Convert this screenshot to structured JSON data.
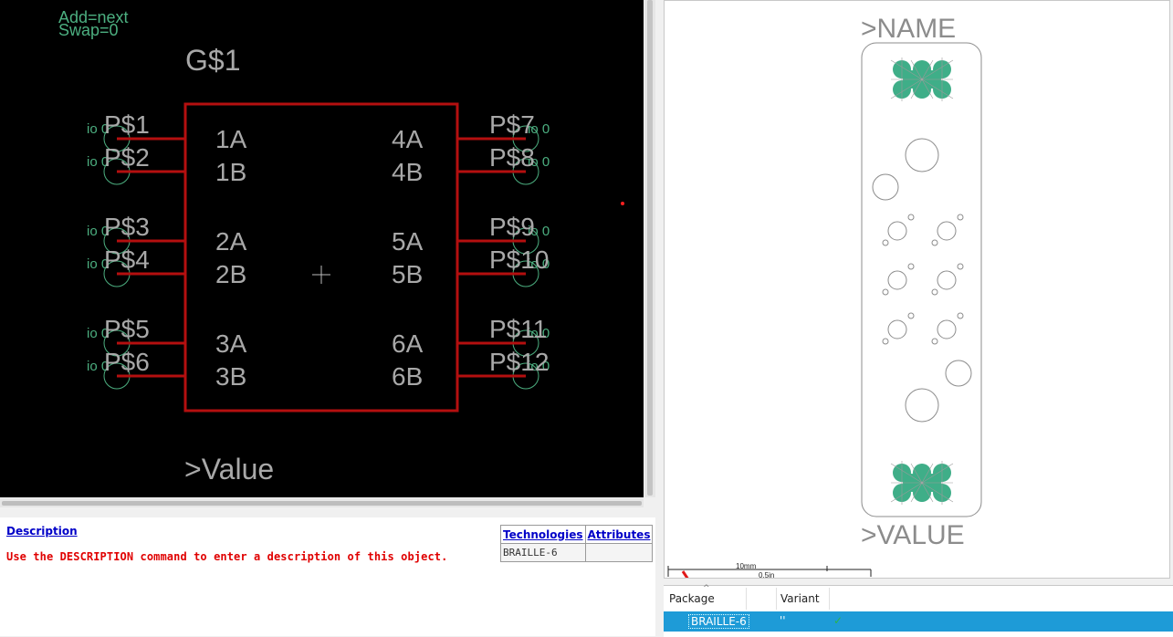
{
  "schematic": {
    "add_label": "Add=next",
    "swap_label": "Swap=0",
    "gate_name": "G$1",
    "value_label": ">Value",
    "pin_io_label": "io 0",
    "pins_left": [
      "P$1",
      "P$2",
      "P$3",
      "P$4",
      "P$5",
      "P$6"
    ],
    "pins_right": [
      "P$7",
      "P$8",
      "P$9",
      "P$10",
      "P$11",
      "P$12"
    ],
    "inner_left": [
      "1A",
      "1B",
      "2A",
      "2B",
      "3A",
      "3B"
    ],
    "inner_right": [
      "4A",
      "4B",
      "5A",
      "5B",
      "6A",
      "6B"
    ],
    "colors": {
      "body": "#b40f0f",
      "text": "#a8a8a8",
      "io_text": "#4caf80",
      "background": "#000000"
    }
  },
  "description": {
    "link": "Description",
    "text": "Use the DESCRIPTION command to enter a description of this object."
  },
  "tech_table": {
    "headers": [
      "Technologies",
      "Attributes"
    ],
    "rows": [
      [
        "BRAILLE-6",
        ""
      ]
    ]
  },
  "package_view": {
    "name_label": ">NAME",
    "value_label": ">VALUE",
    "scale_mm": "10mm",
    "scale_in": "0.5in",
    "colors": {
      "pad": "#3fae88",
      "outline": "#8c8c8c"
    }
  },
  "package_table": {
    "headers": [
      "Package",
      "Variant"
    ],
    "rows": [
      {
        "package": "BRAILLE-6",
        "variant": "''",
        "check_icon": "check-icon"
      }
    ],
    "selected_color": "#1e9bd7"
  }
}
